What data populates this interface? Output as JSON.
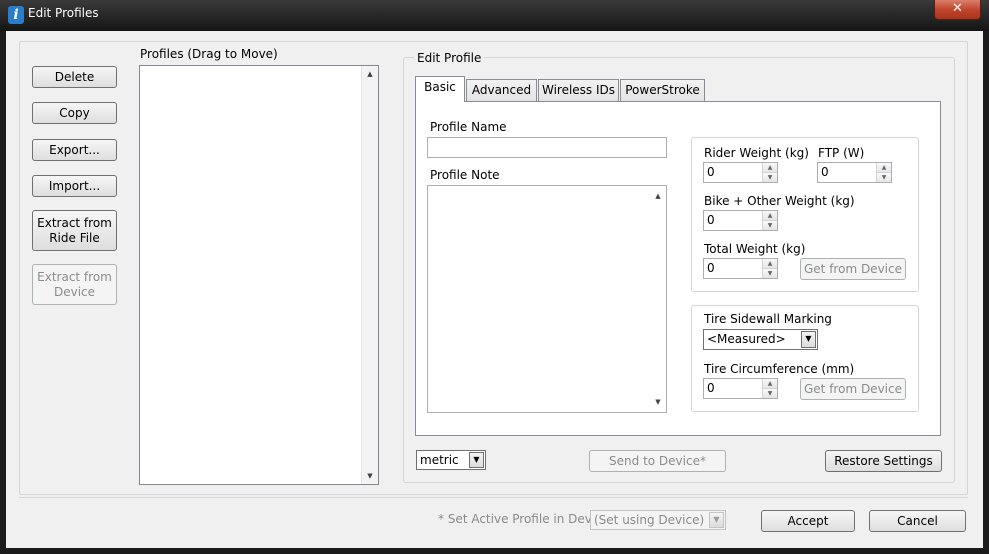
{
  "window": {
    "title": "Edit Profiles",
    "close_glyph": "✕"
  },
  "left_buttons": {
    "delete": "Delete",
    "copy": "Copy",
    "export": "Export...",
    "import": "Import...",
    "extract_ride_line1": "Extract from",
    "extract_ride_line2": "Ride File",
    "extract_device_line1": "Extract from",
    "extract_device_line2": "Device"
  },
  "profiles_list": {
    "label": "Profiles (Drag to Move)",
    "items": []
  },
  "edit_profile": {
    "group_label": "Edit Profile",
    "tabs": [
      "Basic",
      "Advanced",
      "Wireless IDs",
      "PowerStroke"
    ],
    "active_tab": "Basic",
    "profile_name_label": "Profile Name",
    "profile_name_value": "",
    "profile_note_label": "Profile Note",
    "profile_note_value": "",
    "rider_weight_label": "Rider Weight (kg)",
    "rider_weight_value": "0",
    "ftp_label": "FTP (W)",
    "ftp_value": "0",
    "bike_weight_label": "Bike + Other Weight (kg)",
    "bike_weight_value": "0",
    "total_weight_label": "Total Weight (kg)",
    "total_weight_value": "0",
    "get_from_device_weight": "Get from Device",
    "tire_marking_label": "Tire Sidewall Marking",
    "tire_marking_value": "<Measured>",
    "tire_circ_label": "Tire Circumference (mm)",
    "tire_circ_value": "0",
    "get_from_device_tire": "Get from Device"
  },
  "bottom": {
    "units_value": "metric",
    "send_to_device": "Send to Device*",
    "restore_settings": "Restore Settings",
    "active_profile_label": "* Set Active Profile in Device",
    "active_profile_value": "(Set using Device)",
    "accept": "Accept",
    "cancel": "Cancel"
  },
  "icons": {
    "app": "app-logo-icon",
    "scroll_up": "▲",
    "scroll_down": "▼",
    "dropdown": "▼"
  }
}
